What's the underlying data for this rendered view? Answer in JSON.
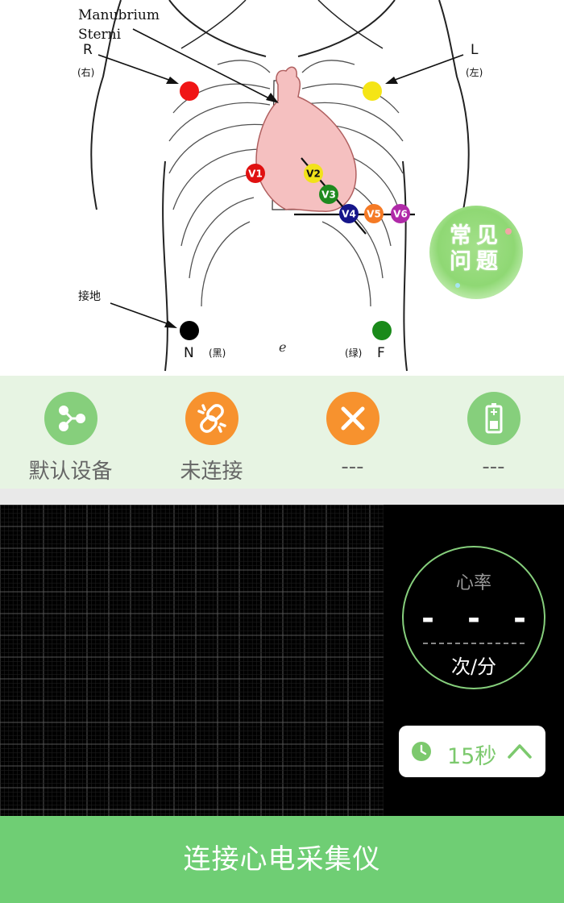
{
  "diagram": {
    "labels": {
      "manubrium_line1": "Manubrium",
      "manubrium_line2": "Sterni",
      "right": "R",
      "right_cn": "(右)",
      "left": "L",
      "left_cn": "(左)",
      "ground": "接地",
      "neutral": "N",
      "neutral_cn": "(黑)",
      "foot": "F",
      "foot_cn": "(绿)"
    },
    "leads": [
      {
        "label": "V1",
        "color": "#e01010"
      },
      {
        "label": "V2",
        "color": "#f2e21a"
      },
      {
        "label": "V3",
        "color": "#1f8a1f"
      },
      {
        "label": "V4",
        "color": "#16168a"
      },
      {
        "label": "V5",
        "color": "#f57a25"
      },
      {
        "label": "V6",
        "color": "#b02aa8"
      }
    ],
    "limb_colors": {
      "R": "#f01515",
      "L": "#f5e516",
      "N": "#000000",
      "F": "#1a8a1a"
    }
  },
  "faq": {
    "text": "常见问题"
  },
  "status": {
    "items": [
      {
        "icon": "share-icon",
        "label": "默认设备",
        "color": "#86cf7c"
      },
      {
        "icon": "broken-link-icon",
        "label": "未连接",
        "color": "#f7922e"
      },
      {
        "icon": "close-icon",
        "label": "---",
        "color": "#f7922e"
      },
      {
        "icon": "battery-icon",
        "label": "---",
        "color": "#86cf7c"
      }
    ]
  },
  "heart_rate": {
    "title": "心率",
    "value": "- - -",
    "unit": "次/分"
  },
  "timer": {
    "label": "15秒",
    "icon": "clock-icon"
  },
  "connect_button": {
    "label": "连接心电采集仪"
  },
  "colors": {
    "accent": "#6fce74",
    "warning": "#f7922e",
    "panel": "#e7f4e3"
  }
}
